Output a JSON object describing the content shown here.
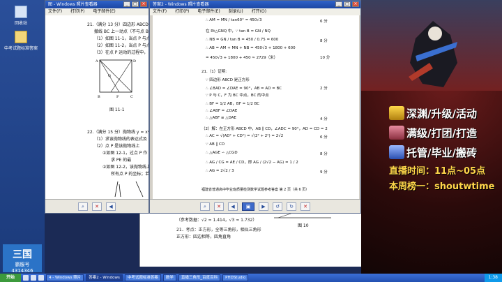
{
  "desktop": {
    "icons": [
      {
        "label": "回收站",
        "icon": "recycle-bin-icon"
      },
      {
        "label": "中考试题标准答案",
        "icon": "folder-icon"
      }
    ],
    "logo": {
      "big": "三国",
      "mid": "霸服号",
      "num": "4314346"
    }
  },
  "window_left": {
    "title": "图 - Windows 照片查看器",
    "menu": [
      "文件(F)",
      "打印(P)",
      "电子邮件(E)"
    ],
    "question21": {
      "line1": "21.（满分 13 分）四边形 ABCD 是正",
      "line2": "撤线 BC 上一动点（不与点 B 重",
      "line3": "（1）如图 11-1，当点 P 与点",
      "line4": "（2）如图 11-2，当点 P 与点 C 不",
      "line5": "（3）在点 P 运动的过程中，",
      "fig_label": "图 11-1",
      "pts": {
        "A": "A",
        "D": "D",
        "G": "G",
        "B": "B",
        "F": "F",
        "C": "C"
      }
    },
    "question22": {
      "line1": "22.（满分 15 分）抛物线 y = x² + b",
      "line2": "（1）求该抛物线的表达式及",
      "line3": "（2）点 P 是该抛物线上",
      "line4": "①如图 12-1，过点 P 作",
      "line5": "求 PE 的最",
      "line6": "②如图 12-2，该抛物线上",
      "line7": "所有点 P 的坐标；若不存"
    }
  },
  "window_right": {
    "title": "答案2 - Windows 照片查看器",
    "menu": [
      "文件(F)",
      "打印(P)",
      "电子邮件(E)",
      "刻录(U)",
      "打开(O)"
    ],
    "lines": [
      {
        "text": "∴ AM = MN / tan60° = 450√3",
        "score": "6 分"
      },
      {
        "text": "在 Rt△GNQ 中，∵ tan B = GN / NQ",
        "score": ""
      },
      {
        "text": "∴ NB = GN / tan B = 450 / 0.75 = 600",
        "score": "8 分"
      },
      {
        "text": "∴ AB = AM + MN + NB = 450√3 + 1800 + 600",
        "score": ""
      },
      {
        "text": "= 450√3 + 1800 + 450 ≈ 2729（米）",
        "score": "10 分"
      },
      {
        "text": "21.（1）证明:",
        "score": ""
      },
      {
        "text": "∵ 四边形 ABCD 是正方形",
        "score": ""
      },
      {
        "text": "∴ ∠BAD = ∠DAE = 90°，AB = AD = BC",
        "score": "2 分"
      },
      {
        "text": "∵ P 与 C，F 为 BC 中点，BC 的中点",
        "score": ""
      },
      {
        "text": "∴ BF = 1/2 AB，BF = 1/2 BC",
        "score": ""
      },
      {
        "text": "∴ ∠ABF = ∠DAE",
        "score": ""
      },
      {
        "text": "∴ △ABF ≌ △DAE",
        "score": "4 分"
      },
      {
        "text": "（2）解：在正方形 ABCD 中，AB ∥ CD，∠ADC = 90°，AD = CD = 2",
        "score": ""
      },
      {
        "text": "∴ AC = √(AD² + CD²) = √(2² + 2²) = 2√2",
        "score": "6 分"
      },
      {
        "text": "∵ AB ∥ CD",
        "score": ""
      },
      {
        "text": "∴ △AGE ∽ △CGD",
        "score": "8 分"
      },
      {
        "text": "∴ AG / CG = AE / CD，即 AG / (2√2 − AG) = 1 / 2",
        "score": ""
      },
      {
        "text": "∴ AG = 2√2 / 3",
        "score": "9 分"
      }
    ],
    "footer": "福建省普通高中毕业班质量检测数学试题参考答案 第 2 页（共 6 页）"
  },
  "bg_doc": {
    "ref_line": "（参考数据：√2 ≈ 1.414，√3 ≈ 1.732）",
    "q21": "21．考点：正方形，全等三角形，相似三角形",
    "q21b": "正方形：四边相等，四角直角",
    "fig": "图 10"
  },
  "promo": {
    "lines": [
      "深渊/升级/活动",
      "满级/打团/打造",
      "托管/毕业/搬砖"
    ],
    "live_time": "直播时间：11点~05点",
    "weekly": "本周榜一：shoutwtime"
  },
  "taskbar": {
    "start": "开始",
    "tasks": [
      {
        "label": "4 - Windows 照片",
        "active": false
      },
      {
        "label": "答案2 - Windows",
        "active": true
      },
      {
        "label": "中考试题标准答案",
        "active": false
      },
      {
        "label": "数学",
        "active": false
      },
      {
        "label": "直播三角形_百度百科",
        "active": false
      },
      {
        "label": "PHDStudio",
        "active": false
      }
    ],
    "clock": "1:38"
  },
  "colors": {
    "title_blue": "#1c46a3",
    "promo_yellow": "#ffd64a",
    "taskbar": "#2350b0"
  }
}
